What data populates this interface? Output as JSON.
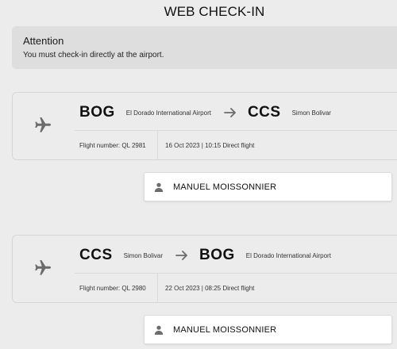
{
  "page": {
    "title": "WEB CHECK-IN"
  },
  "alert": {
    "title": "Attention",
    "message": "You must check-in directly at the airport."
  },
  "flights": [
    {
      "origin_code": "BOG",
      "origin_airport": "El Dorado International Airport",
      "destination_code": "CCS",
      "destination_airport": "Simon Bolivar",
      "flight_number": "Flight number: QL 2981",
      "date_info": "16 Oct 2023 | 10:15 Direct flight",
      "passenger": "MANUEL MOISSONNIER"
    },
    {
      "origin_code": "CCS",
      "origin_airport": "Simon Bolivar",
      "destination_code": "BOG",
      "destination_airport": "El Dorado International Airport",
      "flight_number": "Flight number: QL 2980",
      "date_info": "22 Oct 2023 | 08:25 Direct flight",
      "passenger": "MANUEL MOISSONNIER"
    }
  ],
  "icons": {
    "plane": "plane-icon",
    "arrow": "arrow-right-icon",
    "user": "user-icon"
  },
  "colors": {
    "background": "#ececec",
    "alert_bg": "#dedede",
    "icon_gray": "#6b6b6b",
    "passenger_bg": "#ffffff"
  }
}
